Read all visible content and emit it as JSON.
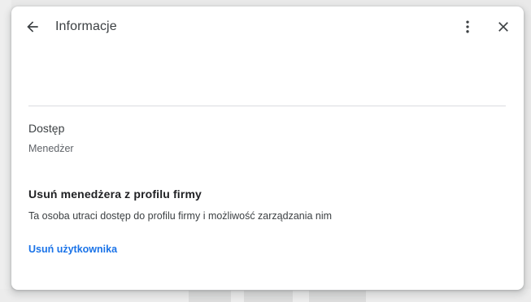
{
  "dialog": {
    "title": "Informacje",
    "icons": {
      "back": "arrow-back-icon",
      "more": "more-vert-icon",
      "close": "close-icon"
    }
  },
  "access": {
    "label": "Dostęp",
    "value": "Menedżer"
  },
  "remove_section": {
    "title": "Usuń menedżera z profilu firmy",
    "description": "Ta osoba utraci dostęp do profilu firmy i możliwość zarządzania nim",
    "action_label": "Usuń użytkownika"
  },
  "colors": {
    "link": "#1a73e8",
    "text_primary": "#202124",
    "text_secondary": "#5f6368",
    "divider": "#dadce0"
  }
}
